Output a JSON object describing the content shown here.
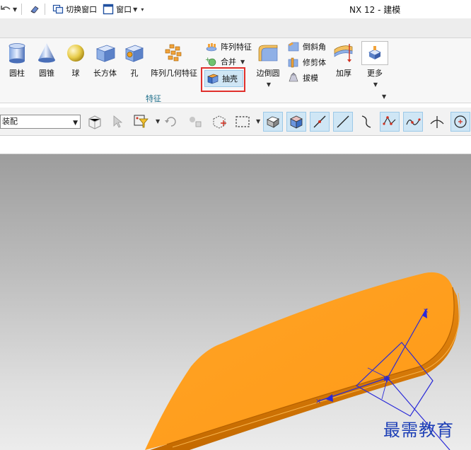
{
  "titlebar": {
    "switch_window_label": "切换窗口",
    "window_menu_label": "窗口",
    "app_title": "NX 12 - 建模"
  },
  "ribbon": {
    "buttons": {
      "cylinder": "圆柱",
      "cone": "圆锥",
      "sphere": "球",
      "block": "长方体",
      "hole": "孔",
      "pattern_geometry": "阵列几何特征",
      "edge_blend": "边倒圆",
      "thicken": "加厚",
      "more": "更多"
    },
    "small_buttons": {
      "pattern_feature": "阵列特征",
      "unite": "合并",
      "shell": "抽壳",
      "chamfer": "倒斜角",
      "trim_body": "修剪体",
      "draft": "拔模"
    },
    "group_label": "特征",
    "accent_color": "#1f6f8b",
    "highlight_color": "#e0302c"
  },
  "command_bar": {
    "selection_filter_value": "装配"
  },
  "viewport": {
    "part_color": "#ff9d1a",
    "csys_color": "#2a2ad8"
  },
  "watermark": {
    "text": "最需教育"
  }
}
